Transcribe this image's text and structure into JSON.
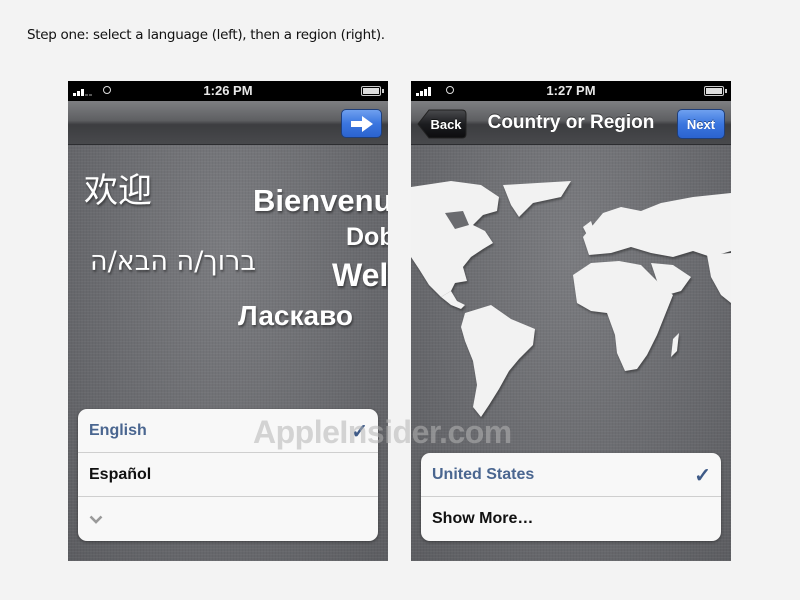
{
  "caption": "Step one: select a language (left), then a region (right).",
  "watermark": "AppleInsider.com",
  "left_screen": {
    "status": {
      "time": "1:26 PM"
    },
    "nav": {
      "next_icon": "right-arrow-icon"
    },
    "welcome_words": {
      "chinese": "欢迎",
      "french": "Bienvenu",
      "dobro": "Dob",
      "hebrew": "ברוך/ה הבא/ה",
      "welcome": "Wel",
      "ukrainian": "Ласкаво"
    },
    "language_list": [
      {
        "label": "English",
        "selected": true
      },
      {
        "label": "Español",
        "selected": false
      },
      {
        "label": "",
        "icon": "chevron-down-icon"
      }
    ]
  },
  "right_screen": {
    "status": {
      "time": "1:27 PM"
    },
    "nav": {
      "back_label": "Back",
      "title": "Country or Region",
      "next_label": "Next"
    },
    "region_list": [
      {
        "label": "United States",
        "selected": true
      },
      {
        "label": "Show More…",
        "selected": false
      }
    ]
  },
  "colors": {
    "accent_blue": "#3b76df",
    "selected_text": "#4a6690",
    "background": "#f3f3f3"
  },
  "checkmark": "✓"
}
